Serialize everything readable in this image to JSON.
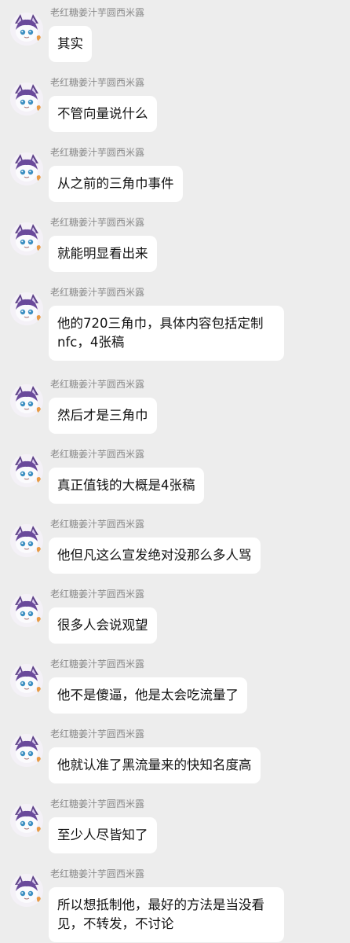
{
  "chat": {
    "messages": [
      {
        "sender": "老红糖姜汁芋圆西米露",
        "text": "其实"
      },
      {
        "sender": "老红糖姜汁芋圆西米露",
        "text": "不管向量说什么"
      },
      {
        "sender": "老红糖姜汁芋圆西米露",
        "text": "从之前的三角巾事件"
      },
      {
        "sender": "老红糖姜汁芋圆西米露",
        "text": "就能明显看出来"
      },
      {
        "sender": "老红糖姜汁芋圆西米露",
        "text": "他的720三角巾，具体内容包括定制nfc，4张稿"
      },
      {
        "sender": "老红糖姜汁芋圆西米露",
        "text": "然后才是三角巾"
      },
      {
        "sender": "老红糖姜汁芋圆西米露",
        "text": "真正值钱的大概是4张稿"
      },
      {
        "sender": "老红糖姜汁芋圆西米露",
        "text": "他但凡这么宣发绝对没那么多人骂"
      },
      {
        "sender": "老红糖姜汁芋圆西米露",
        "text": "很多人会说观望"
      },
      {
        "sender": "老红糖姜汁芋圆西米露",
        "text": "他不是傻逼，他是太会吃流量了"
      },
      {
        "sender": "老红糖姜汁芋圆西米露",
        "text": "他就认准了黑流量来的快知名度高"
      },
      {
        "sender": "老红糖姜汁芋圆西米露",
        "text": "至少人尽皆知了"
      },
      {
        "sender": "老红糖姜汁芋圆西米露",
        "text": "所以想抵制他，最好的方法是当没看见，不转发，不讨论"
      }
    ]
  },
  "colors": {
    "background": "#ededed",
    "bubble": "#ffffff",
    "sender_name": "#8a8a8a",
    "text": "#111111"
  },
  "icons": {
    "avatar": "avatar-icon"
  }
}
